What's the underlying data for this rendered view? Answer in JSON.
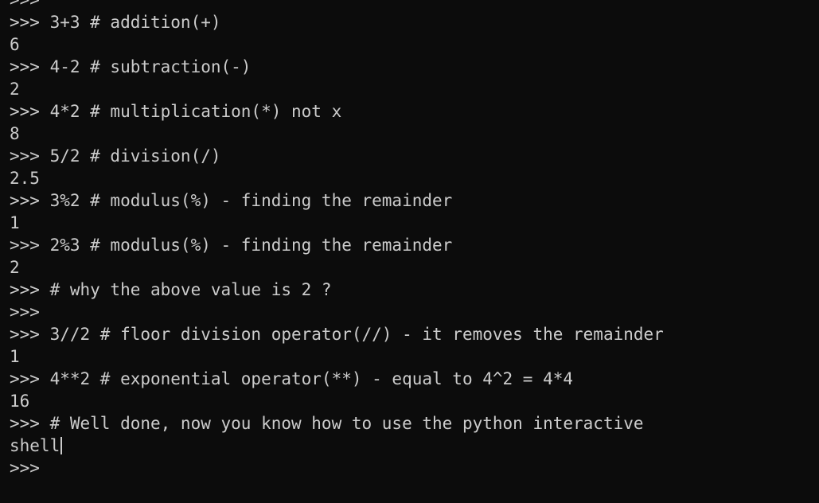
{
  "terminal": {
    "lines": [
      ">>>",
      ">>> 3+3 # addition(+)",
      "6",
      ">>> 4-2 # subtraction(-)",
      "2",
      ">>> 4*2 # multiplication(*) not x",
      "8",
      ">>> 5/2 # division(/)",
      "2.5",
      ">>> 3%2 # modulus(%) - finding the remainder",
      "1",
      ">>> 2%3 # modulus(%) - finding the remainder",
      "2",
      ">>> # why the above value is 2 ?",
      ">>>",
      ">>> 3//2 # floor division operator(//) - it removes the remainder",
      "1",
      ">>> 4**2 # exponential operator(**) - equal to 4^2 = 4*4",
      "16",
      ">>> # Well done, now you know how to use the python interactive",
      "shell",
      ">>>"
    ],
    "colors": {
      "background": "#0c0c0c",
      "foreground": "#cccccc"
    }
  }
}
